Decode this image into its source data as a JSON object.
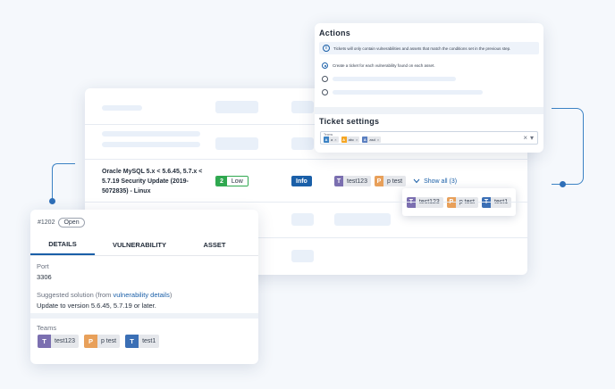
{
  "colors": {
    "accent": "#1a5fa8",
    "low": "#2fa84f",
    "team_t": "#7b6fb0",
    "team_p": "#e8a05a",
    "team_t1": "#3b6fb5",
    "chip_a": "#3b82c4",
    "chip_b": "#f5a623",
    "chip_c": "#5a7fc0"
  },
  "table": {
    "vulnerability": "Oracle MySQL 5.x < 5.6.45, 5.7.x < 5.7.19 Security Update (2019-5072835) - Linux",
    "severity_score": "2",
    "severity_label": "Low",
    "status": "Info",
    "teams": [
      {
        "initial": "T",
        "name": "test123"
      },
      {
        "initial": "P",
        "name": "p test"
      }
    ],
    "show_all": "Show all (3)",
    "popover_teams": [
      {
        "initial": "T",
        "name": "test123"
      },
      {
        "initial": "P",
        "name": "p test"
      },
      {
        "initial": "T",
        "name": "test1"
      }
    ]
  },
  "actions": {
    "title": "Actions",
    "info": "Tickets will only contain vulnerabilities and assets that match the conditions set in the previous step.",
    "option1": "Create a ticket for each vulnerability found on each asset.",
    "settings_title": "Ticket settings",
    "teams_label": "Teams",
    "selected_chips": [
      {
        "initial": "A",
        "name": "a"
      },
      {
        "initial": "A",
        "name": "abc"
      },
      {
        "initial": "A",
        "name": "asd"
      }
    ],
    "clear_icon": "×",
    "caret_icon": "▾"
  },
  "detail": {
    "ticket_id": "#1202",
    "status": "Open",
    "tabs": [
      "DETAILS",
      "VULNERABILITY",
      "ASSET"
    ],
    "port_label": "Port",
    "port_value": "3306",
    "solution_label": "Suggested solution (from ",
    "solution_link": "vulnerability details",
    "solution_close": ")",
    "solution_value": "Update to version 5.6.45, 5.7.19 or later.",
    "teams_label": "Teams",
    "teams": [
      {
        "initial": "T",
        "name": "test123"
      },
      {
        "initial": "P",
        "name": "p test"
      },
      {
        "initial": "T",
        "name": "test1"
      }
    ]
  }
}
